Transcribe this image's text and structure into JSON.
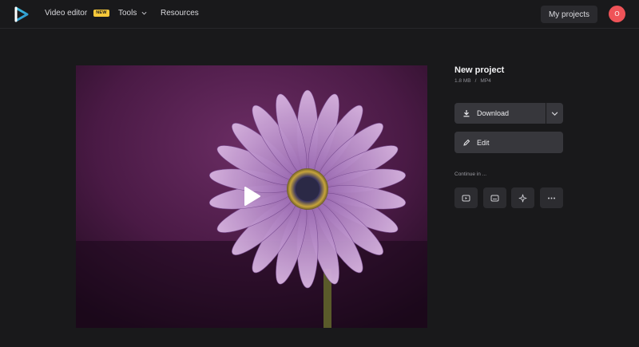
{
  "header": {
    "nav": {
      "video_editor": "Video editor",
      "video_editor_badge": "NEW",
      "tools": "Tools",
      "resources": "Resources"
    },
    "my_projects": "My projects",
    "avatar_initial": "O"
  },
  "project": {
    "title": "New project",
    "size": "1.8 MB",
    "separator": "/",
    "format": "MP4"
  },
  "actions": {
    "download": "Download",
    "edit": "Edit"
  },
  "continue": {
    "label": "Continue in ...",
    "tiles": [
      "video-player-icon",
      "subtitles-icon",
      "sparkle-icon",
      "more-icon"
    ]
  },
  "colors": {
    "background": "#19191b",
    "button": "#37373c",
    "avatar": "#ef5358",
    "badge": "#f6c83a",
    "logo_accent": "#41c6e6"
  }
}
